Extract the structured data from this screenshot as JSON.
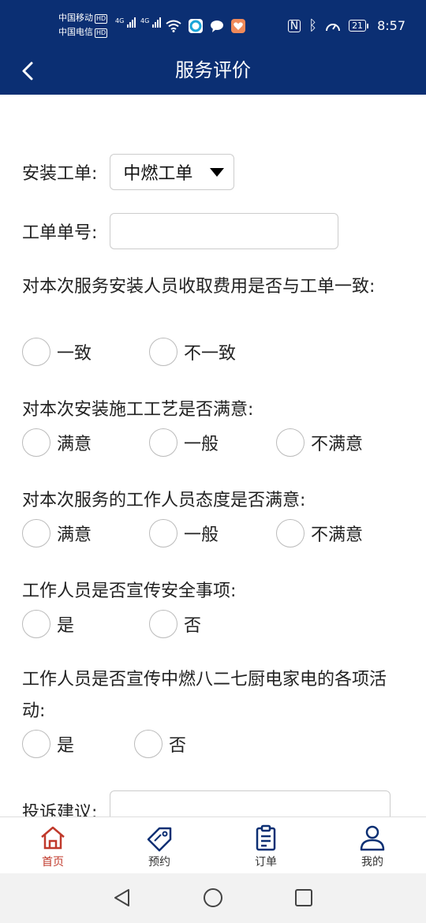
{
  "status_bar": {
    "carrier1": "中国移动",
    "carrier2": "中国电信",
    "hd": "HD",
    "net": "4G",
    "battery": "21",
    "time": "8:57"
  },
  "header": {
    "title": "服务评价"
  },
  "form": {
    "install_order_label": "安装工单:",
    "install_order_value": "中燃工单",
    "order_no_label": "工单单号:",
    "order_no_value": "",
    "questions": [
      {
        "text": "对本次服务安装人员收取费用是否与工单一致:",
        "options": [
          "一致",
          "不一致"
        ]
      },
      {
        "text": "对本次安装施工工艺是否满意:",
        "options": [
          "满意",
          "一般",
          "不满意"
        ]
      },
      {
        "text": "对本次服务的工作人员态度是否满意:",
        "options": [
          "满意",
          "一般",
          "不满意"
        ]
      },
      {
        "text": "工作人员是否宣传安全事项:",
        "options": [
          "是",
          "否"
        ]
      },
      {
        "text": "工作人员是否宣传中燃八二七厨电家电的各项活动:",
        "options": [
          "是",
          "否"
        ]
      }
    ],
    "complaint_label": "投诉建议:",
    "complaint_value": ""
  },
  "bottom_nav": {
    "items": [
      {
        "label": "首页",
        "icon": "home-icon",
        "active": true
      },
      {
        "label": "预约",
        "icon": "tag-icon",
        "active": false
      },
      {
        "label": "订单",
        "icon": "clipboard-icon",
        "active": false
      },
      {
        "label": "我的",
        "icon": "user-icon",
        "active": false
      }
    ],
    "active_color": "#c0392b"
  },
  "colors": {
    "header_bg": "#0b2f73"
  }
}
